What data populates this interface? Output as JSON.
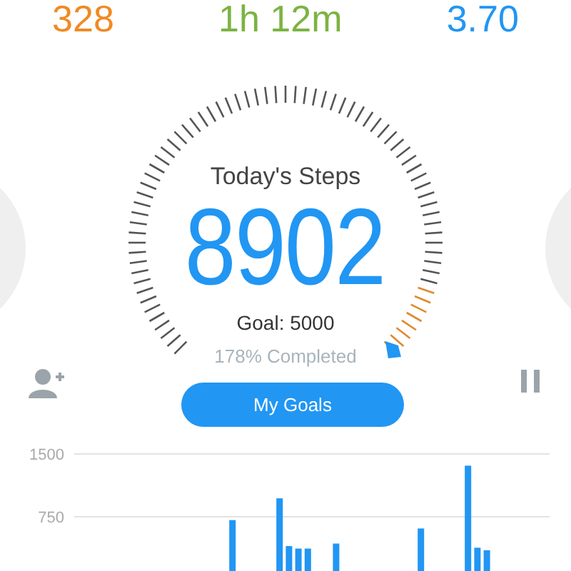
{
  "stats": [
    {
      "value": "328",
      "color": "#f08a24"
    },
    {
      "value": "1h 12m",
      "color": "#7cb342"
    },
    {
      "value": "3.70",
      "color": "#2196f3"
    }
  ],
  "gauge": {
    "title": "Today's Steps",
    "steps": "8902",
    "goal": "Goal: 5000",
    "completed": "178% Completed"
  },
  "actions": {
    "button": "My Goals"
  },
  "chart_data": {
    "type": "bar",
    "yticks": [
      750,
      1500
    ],
    "ylim": [
      0,
      1500
    ],
    "values": [
      null,
      null,
      null,
      null,
      null,
      null,
      null,
      null,
      null,
      null,
      null,
      null,
      null,
      null,
      null,
      null,
      710,
      null,
      null,
      null,
      null,
      970,
      400,
      370,
      370,
      null,
      null,
      430,
      null,
      null,
      null,
      null,
      null,
      null,
      null,
      null,
      610,
      null,
      null,
      null,
      null,
      1360,
      380,
      350,
      null,
      null,
      null,
      null,
      null,
      null
    ]
  }
}
